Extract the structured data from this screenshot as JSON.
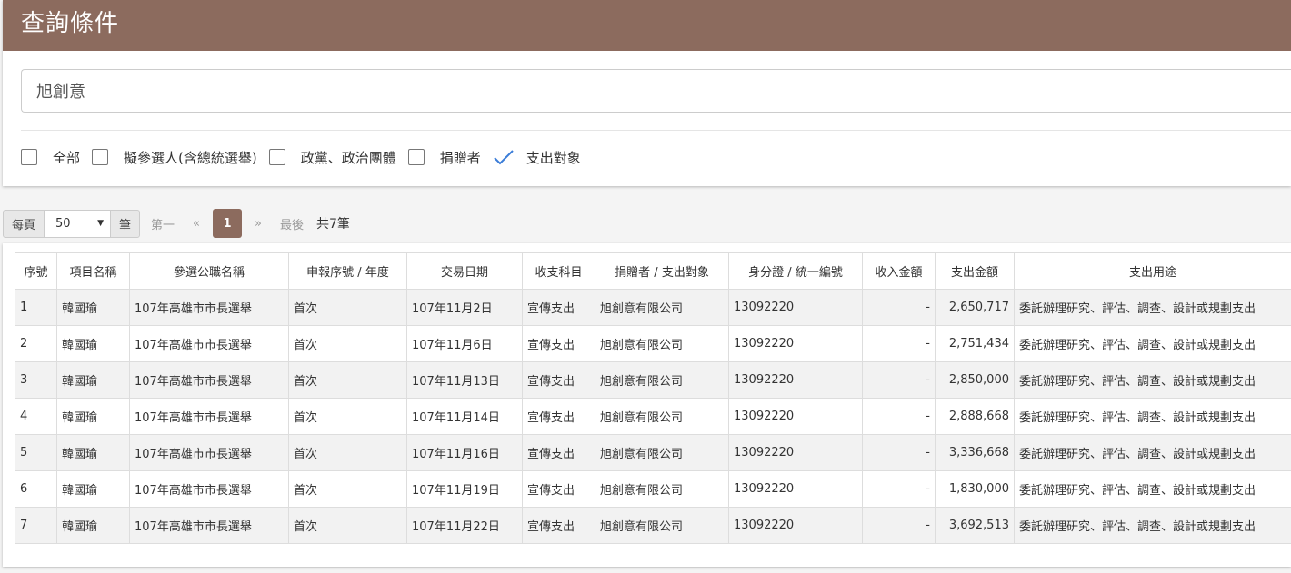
{
  "query": {
    "title": "查詢條件",
    "search_value": "旭創意",
    "filters": [
      {
        "label": "全部",
        "checked": false
      },
      {
        "label": "擬參選人(含總統選舉)",
        "checked": false
      },
      {
        "label": "政黨、政治團體",
        "checked": false
      },
      {
        "label": "捐贈者",
        "checked": false
      },
      {
        "label": "支出對象",
        "checked": true
      }
    ]
  },
  "pager": {
    "per_page_label": "每頁",
    "per_page_value": "50",
    "unit_label": "筆",
    "first_label": "第一",
    "prev_label": "«",
    "current_page": "1",
    "next_label": "»",
    "last_label": "最後",
    "total_label": "共7筆"
  },
  "table": {
    "headers": [
      "序號",
      "項目名稱",
      "參選公職名稱",
      "申報序號 / 年度",
      "交易日期",
      "收支科目",
      "捐贈者 / 支出對象",
      "身分證 / 統一編號",
      "收入金額",
      "支出金額",
      "支出用途"
    ],
    "rows": [
      [
        "1",
        "韓國瑜",
        "107年高雄市市長選舉",
        "首次",
        "107年11月2日",
        "宣傳支出",
        "旭創意有限公司",
        "13092220",
        "-",
        "2,650,717",
        "委託辦理研究、評估、調查、設計或規劃支出"
      ],
      [
        "2",
        "韓國瑜",
        "107年高雄市市長選舉",
        "首次",
        "107年11月6日",
        "宣傳支出",
        "旭創意有限公司",
        "13092220",
        "-",
        "2,751,434",
        "委託辦理研究、評估、調查、設計或規劃支出"
      ],
      [
        "3",
        "韓國瑜",
        "107年高雄市市長選舉",
        "首次",
        "107年11月13日",
        "宣傳支出",
        "旭創意有限公司",
        "13092220",
        "-",
        "2,850,000",
        "委託辦理研究、評估、調查、設計或規劃支出"
      ],
      [
        "4",
        "韓國瑜",
        "107年高雄市市長選舉",
        "首次",
        "107年11月14日",
        "宣傳支出",
        "旭創意有限公司",
        "13092220",
        "-",
        "2,888,668",
        "委託辦理研究、評估、調查、設計或規劃支出"
      ],
      [
        "5",
        "韓國瑜",
        "107年高雄市市長選舉",
        "首次",
        "107年11月16日",
        "宣傳支出",
        "旭創意有限公司",
        "13092220",
        "-",
        "3,336,668",
        "委託辦理研究、評估、調查、設計或規劃支出"
      ],
      [
        "6",
        "韓國瑜",
        "107年高雄市市長選舉",
        "首次",
        "107年11月19日",
        "宣傳支出",
        "旭創意有限公司",
        "13092220",
        "-",
        "1,830,000",
        "委託辦理研究、評估、調查、設計或規劃支出"
      ],
      [
        "7",
        "韓國瑜",
        "107年高雄市市長選舉",
        "首次",
        "107年11月22日",
        "宣傳支出",
        "旭創意有限公司",
        "13092220",
        "-",
        "3,692,513",
        "委託辦理研究、評估、調查、設計或規劃支出"
      ]
    ]
  },
  "colors": {
    "header_brown": "#8c6b5e",
    "check_blue": "#3b7dd8"
  }
}
